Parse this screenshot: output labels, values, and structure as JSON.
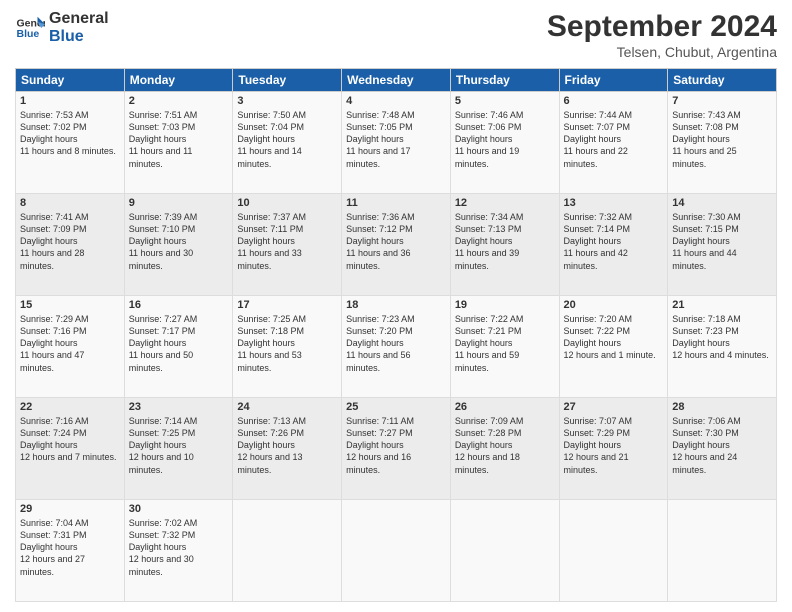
{
  "header": {
    "logo_line1": "General",
    "logo_line2": "Blue",
    "month": "September 2024",
    "location": "Telsen, Chubut, Argentina"
  },
  "weekdays": [
    "Sunday",
    "Monday",
    "Tuesday",
    "Wednesday",
    "Thursday",
    "Friday",
    "Saturday"
  ],
  "weeks": [
    [
      {
        "day": "1",
        "sunrise": "Sunrise: 7:53 AM",
        "sunset": "Sunset: 7:02 PM",
        "daylight": "Daylight: 11 hours and 8 minutes."
      },
      {
        "day": "2",
        "sunrise": "Sunrise: 7:51 AM",
        "sunset": "Sunset: 7:03 PM",
        "daylight": "Daylight: 11 hours and 11 minutes."
      },
      {
        "day": "3",
        "sunrise": "Sunrise: 7:50 AM",
        "sunset": "Sunset: 7:04 PM",
        "daylight": "Daylight: 11 hours and 14 minutes."
      },
      {
        "day": "4",
        "sunrise": "Sunrise: 7:48 AM",
        "sunset": "Sunset: 7:05 PM",
        "daylight": "Daylight: 11 hours and 17 minutes."
      },
      {
        "day": "5",
        "sunrise": "Sunrise: 7:46 AM",
        "sunset": "Sunset: 7:06 PM",
        "daylight": "Daylight: 11 hours and 19 minutes."
      },
      {
        "day": "6",
        "sunrise": "Sunrise: 7:44 AM",
        "sunset": "Sunset: 7:07 PM",
        "daylight": "Daylight: 11 hours and 22 minutes."
      },
      {
        "day": "7",
        "sunrise": "Sunrise: 7:43 AM",
        "sunset": "Sunset: 7:08 PM",
        "daylight": "Daylight: 11 hours and 25 minutes."
      }
    ],
    [
      {
        "day": "8",
        "sunrise": "Sunrise: 7:41 AM",
        "sunset": "Sunset: 7:09 PM",
        "daylight": "Daylight: 11 hours and 28 minutes."
      },
      {
        "day": "9",
        "sunrise": "Sunrise: 7:39 AM",
        "sunset": "Sunset: 7:10 PM",
        "daylight": "Daylight: 11 hours and 30 minutes."
      },
      {
        "day": "10",
        "sunrise": "Sunrise: 7:37 AM",
        "sunset": "Sunset: 7:11 PM",
        "daylight": "Daylight: 11 hours and 33 minutes."
      },
      {
        "day": "11",
        "sunrise": "Sunrise: 7:36 AM",
        "sunset": "Sunset: 7:12 PM",
        "daylight": "Daylight: 11 hours and 36 minutes."
      },
      {
        "day": "12",
        "sunrise": "Sunrise: 7:34 AM",
        "sunset": "Sunset: 7:13 PM",
        "daylight": "Daylight: 11 hours and 39 minutes."
      },
      {
        "day": "13",
        "sunrise": "Sunrise: 7:32 AM",
        "sunset": "Sunset: 7:14 PM",
        "daylight": "Daylight: 11 hours and 42 minutes."
      },
      {
        "day": "14",
        "sunrise": "Sunrise: 7:30 AM",
        "sunset": "Sunset: 7:15 PM",
        "daylight": "Daylight: 11 hours and 44 minutes."
      }
    ],
    [
      {
        "day": "15",
        "sunrise": "Sunrise: 7:29 AM",
        "sunset": "Sunset: 7:16 PM",
        "daylight": "Daylight: 11 hours and 47 minutes."
      },
      {
        "day": "16",
        "sunrise": "Sunrise: 7:27 AM",
        "sunset": "Sunset: 7:17 PM",
        "daylight": "Daylight: 11 hours and 50 minutes."
      },
      {
        "day": "17",
        "sunrise": "Sunrise: 7:25 AM",
        "sunset": "Sunset: 7:18 PM",
        "daylight": "Daylight: 11 hours and 53 minutes."
      },
      {
        "day": "18",
        "sunrise": "Sunrise: 7:23 AM",
        "sunset": "Sunset: 7:20 PM",
        "daylight": "Daylight: 11 hours and 56 minutes."
      },
      {
        "day": "19",
        "sunrise": "Sunrise: 7:22 AM",
        "sunset": "Sunset: 7:21 PM",
        "daylight": "Daylight: 11 hours and 59 minutes."
      },
      {
        "day": "20",
        "sunrise": "Sunrise: 7:20 AM",
        "sunset": "Sunset: 7:22 PM",
        "daylight": "Daylight: 12 hours and 1 minute."
      },
      {
        "day": "21",
        "sunrise": "Sunrise: 7:18 AM",
        "sunset": "Sunset: 7:23 PM",
        "daylight": "Daylight: 12 hours and 4 minutes."
      }
    ],
    [
      {
        "day": "22",
        "sunrise": "Sunrise: 7:16 AM",
        "sunset": "Sunset: 7:24 PM",
        "daylight": "Daylight: 12 hours and 7 minutes."
      },
      {
        "day": "23",
        "sunrise": "Sunrise: 7:14 AM",
        "sunset": "Sunset: 7:25 PM",
        "daylight": "Daylight: 12 hours and 10 minutes."
      },
      {
        "day": "24",
        "sunrise": "Sunrise: 7:13 AM",
        "sunset": "Sunset: 7:26 PM",
        "daylight": "Daylight: 12 hours and 13 minutes."
      },
      {
        "day": "25",
        "sunrise": "Sunrise: 7:11 AM",
        "sunset": "Sunset: 7:27 PM",
        "daylight": "Daylight: 12 hours and 16 minutes."
      },
      {
        "day": "26",
        "sunrise": "Sunrise: 7:09 AM",
        "sunset": "Sunset: 7:28 PM",
        "daylight": "Daylight: 12 hours and 18 minutes."
      },
      {
        "day": "27",
        "sunrise": "Sunrise: 7:07 AM",
        "sunset": "Sunset: 7:29 PM",
        "daylight": "Daylight: 12 hours and 21 minutes."
      },
      {
        "day": "28",
        "sunrise": "Sunrise: 7:06 AM",
        "sunset": "Sunset: 7:30 PM",
        "daylight": "Daylight: 12 hours and 24 minutes."
      }
    ],
    [
      {
        "day": "29",
        "sunrise": "Sunrise: 7:04 AM",
        "sunset": "Sunset: 7:31 PM",
        "daylight": "Daylight: 12 hours and 27 minutes."
      },
      {
        "day": "30",
        "sunrise": "Sunrise: 7:02 AM",
        "sunset": "Sunset: 7:32 PM",
        "daylight": "Daylight: 12 hours and 30 minutes."
      },
      null,
      null,
      null,
      null,
      null
    ]
  ]
}
